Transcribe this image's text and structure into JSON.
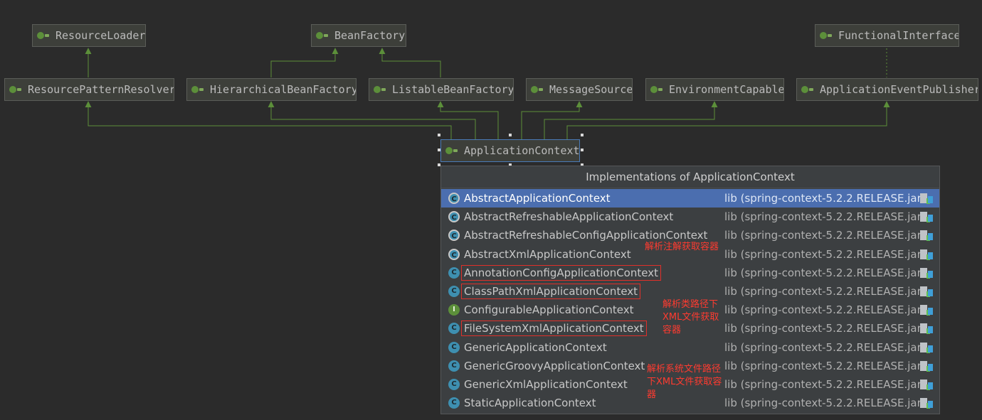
{
  "diagram": {
    "nodes": {
      "resource_loader": "ResourceLoader",
      "bean_factory": "BeanFactory",
      "functional_interface": "FunctionalInterface",
      "resource_pattern_resolver": "ResourcePatternResolver",
      "hierarchical_bean_factory": "HierarchicalBeanFactory",
      "listable_bean_factory": "ListableBeanFactory",
      "message_source": "MessageSource",
      "environment_capable": "EnvironmentCapable",
      "application_event_publisher": "ApplicationEventPublisher",
      "application_context": "ApplicationContext"
    },
    "colors": {
      "background": "#2b2b2b",
      "edge": "#5c8f3a",
      "node": "#3d3f3a"
    }
  },
  "popup": {
    "title": "Implementations of ApplicationContext",
    "items": [
      {
        "name": "AbstractApplicationContext",
        "lib": "lib (spring-context-5.2.2.RELEASE.jar)",
        "icon": "abstract-class-icon",
        "selected": true
      },
      {
        "name": "AbstractRefreshableApplicationContext",
        "lib": "lib (spring-context-5.2.2.RELEASE.jar)",
        "icon": "abstract-class-icon"
      },
      {
        "name": "AbstractRefreshableConfigApplicationContext",
        "lib": "lib (spring-context-5.2.2.RELEASE.jar)",
        "icon": "abstract-class-icon"
      },
      {
        "name": "AbstractXmlApplicationContext",
        "lib": "lib (spring-context-5.2.2.RELEASE.jar)",
        "icon": "abstract-class-icon"
      },
      {
        "name": "AnnotationConfigApplicationContext",
        "lib": "lib (spring-context-5.2.2.RELEASE.jar)",
        "icon": "class-icon",
        "highlighted": true
      },
      {
        "name": "ClassPathXmlApplicationContext",
        "lib": "lib (spring-context-5.2.2.RELEASE.jar)",
        "icon": "class-icon",
        "highlighted": true
      },
      {
        "name": "ConfigurableApplicationContext",
        "lib": "lib (spring-context-5.2.2.RELEASE.jar)",
        "icon": "interface-icon"
      },
      {
        "name": "FileSystemXmlApplicationContext",
        "lib": "lib (spring-context-5.2.2.RELEASE.jar)",
        "icon": "class-icon",
        "highlighted": true
      },
      {
        "name": "GenericApplicationContext",
        "lib": "lib (spring-context-5.2.2.RELEASE.jar)",
        "icon": "class-icon"
      },
      {
        "name": "GenericGroovyApplicationContext",
        "lib": "lib (spring-context-5.2.2.RELEASE.jar)",
        "icon": "class-icon"
      },
      {
        "name": "GenericXmlApplicationContext",
        "lib": "lib (spring-context-5.2.2.RELEASE.jar)",
        "icon": "class-icon"
      },
      {
        "name": "StaticApplicationContext",
        "lib": "lib (spring-context-5.2.2.RELEASE.jar)",
        "icon": "class-icon"
      }
    ],
    "colors": {
      "selected_row": "#4b6eaf",
      "annotation": "#ff3b30"
    }
  },
  "annotations": {
    "annotation_config": "解析注解获取容器",
    "classpath_line1": "解析类路径下",
    "classpath_line2": "XML文件获取",
    "classpath_line3": "容器",
    "filesystem_line1": "解析系统文件路径",
    "filesystem_line2": "下XML文件获取容",
    "filesystem_line3": "器"
  }
}
